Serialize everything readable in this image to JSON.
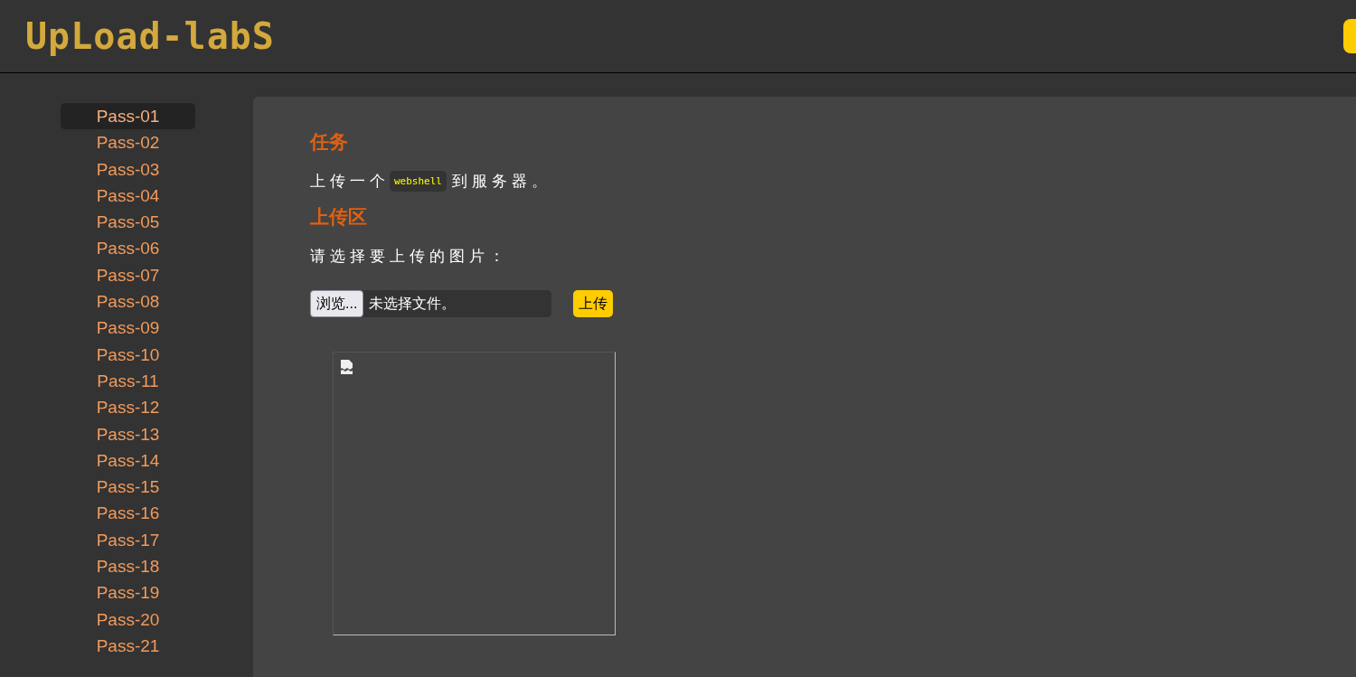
{
  "header": {
    "logo": "UpLoad-labS",
    "corner_button": {
      "kind": "cut"
    }
  },
  "sidebar": {
    "items": [
      {
        "label": "Pass-01",
        "selected": true
      },
      {
        "label": "Pass-02",
        "selected": false
      },
      {
        "label": "Pass-03",
        "selected": false
      },
      {
        "label": "Pass-04",
        "selected": false
      },
      {
        "label": "Pass-05",
        "selected": false
      },
      {
        "label": "Pass-06",
        "selected": false
      },
      {
        "label": "Pass-07",
        "selected": false
      },
      {
        "label": "Pass-08",
        "selected": false
      },
      {
        "label": "Pass-09",
        "selected": false
      },
      {
        "label": "Pass-10",
        "selected": false
      },
      {
        "label": "Pass-11",
        "selected": false
      },
      {
        "label": "Pass-12",
        "selected": false
      },
      {
        "label": "Pass-13",
        "selected": false
      },
      {
        "label": "Pass-14",
        "selected": false
      },
      {
        "label": "Pass-15",
        "selected": false
      },
      {
        "label": "Pass-16",
        "selected": false
      },
      {
        "label": "Pass-17",
        "selected": false
      },
      {
        "label": "Pass-18",
        "selected": false
      },
      {
        "label": "Pass-19",
        "selected": false
      },
      {
        "label": "Pass-20",
        "selected": false
      },
      {
        "label": "Pass-21",
        "selected": false
      }
    ]
  },
  "task": {
    "heading": "任务",
    "text_before": "上传一个",
    "code": "webshell",
    "text_after": "到服务器。"
  },
  "upload": {
    "heading": "上传区",
    "prompt": "请选择要上传的图片：",
    "browse_button": "浏览...",
    "file_status": "未选择文件。",
    "submit_button": "上传",
    "preview": {
      "kind": "broken-image"
    }
  }
}
